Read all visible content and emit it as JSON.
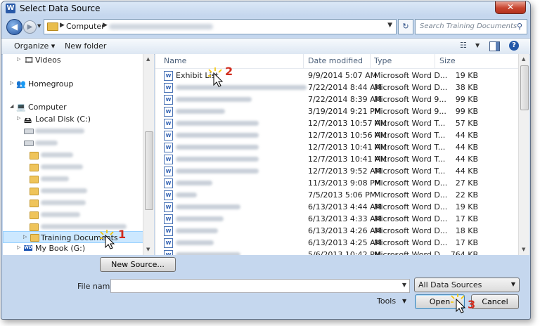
{
  "window": {
    "title": "Select Data Source",
    "app_icon": "W",
    "close_glyph": "✕"
  },
  "navigation": {
    "back_glyph": "◀",
    "forward_glyph": "▶",
    "recent_glyph": "▼",
    "address_root": "Computer",
    "address_sep": "▶",
    "address_dropdown": "▼",
    "refresh_glyph": "↻",
    "search_placeholder": "Search Training Documents",
    "search_glyph": "⚲"
  },
  "toolbar": {
    "organize": "Organize ▾",
    "new_folder": "New folder",
    "view_glyph": "☷",
    "view_dd": "▼",
    "help": "?"
  },
  "nav_pane": {
    "items": [
      {
        "label": "Videos",
        "indent": 1,
        "arrow": "▷",
        "icon": "🎞"
      },
      {
        "label": "Homegroup",
        "indent": 0,
        "arrow": "▷",
        "icon": "👥"
      },
      {
        "label": "Computer",
        "indent": 0,
        "arrow": "◢",
        "icon": "💻"
      },
      {
        "label": "Local Disk (C:)",
        "indent": 1,
        "arrow": "▷",
        "icon": "🖴"
      },
      {
        "label": "My Book (G:)",
        "indent": 1,
        "arrow": "▷",
        "icon": "WD"
      },
      {
        "label": "Training Documents",
        "indent": 2,
        "arrow": "▷",
        "icon": "folder"
      }
    ]
  },
  "columns": {
    "name": "Name",
    "date": "Date modified",
    "type": "Type",
    "size": "Size"
  },
  "files": [
    {
      "name": "Exhibit List",
      "date": "9/9/2014 5:07 AM",
      "type": "Microsoft Word D...",
      "size": "19 KB",
      "blurred": false
    },
    {
      "name": "",
      "date": "7/22/2014 8:44 AM",
      "type": "Microsoft Word D...",
      "size": "38 KB",
      "blurred": true
    },
    {
      "name": "",
      "date": "7/22/2014 8:39 AM",
      "type": "Microsoft Word 9...",
      "size": "99 KB",
      "blurred": true
    },
    {
      "name": "",
      "date": "3/19/2014 9:21 PM",
      "type": "Microsoft Word 9...",
      "size": "99 KB",
      "blurred": true
    },
    {
      "name": "",
      "date": "12/7/2013 10:57 AM",
      "type": "Microsoft Word T...",
      "size": "57 KB",
      "blurred": true
    },
    {
      "name": "",
      "date": "12/7/2013 10:56 AM",
      "type": "Microsoft Word T...",
      "size": "44 KB",
      "blurred": true
    },
    {
      "name": "",
      "date": "12/7/2013 10:41 AM",
      "type": "Microsoft Word T...",
      "size": "44 KB",
      "blurred": true
    },
    {
      "name": "",
      "date": "12/7/2013 10:41 AM",
      "type": "Microsoft Word T...",
      "size": "44 KB",
      "blurred": true
    },
    {
      "name": "",
      "date": "12/7/2013 9:52 AM",
      "type": "Microsoft Word T...",
      "size": "44 KB",
      "blurred": true
    },
    {
      "name": "",
      "date": "11/3/2013 9:08 PM",
      "type": "Microsoft Word D...",
      "size": "27 KB",
      "blurred": true
    },
    {
      "name": "",
      "date": "7/5/2013 5:06 PM",
      "type": "Microsoft Word D...",
      "size": "22 KB",
      "blurred": true
    },
    {
      "name": "",
      "date": "6/13/2013 4:44 AM",
      "type": "Microsoft Word D...",
      "size": "19 KB",
      "blurred": true
    },
    {
      "name": "",
      "date": "6/13/2013 4:33 AM",
      "type": "Microsoft Word D...",
      "size": "17 KB",
      "blurred": true
    },
    {
      "name": "",
      "date": "6/13/2013 4:26 AM",
      "type": "Microsoft Word D...",
      "size": "18 KB",
      "blurred": true
    },
    {
      "name": "",
      "date": "6/13/2013 4:25 AM",
      "type": "Microsoft Word D...",
      "size": "17 KB",
      "blurred": true
    },
    {
      "name": "",
      "date": "5/6/2013 10:42 PM",
      "type": "Microsoft Word D...",
      "size": "764 KB",
      "blurred": true
    }
  ],
  "scroll_arrows": {
    "up": "▲",
    "down": "▼"
  },
  "buttons": {
    "new_source": "New Source...",
    "open": "Open",
    "cancel": "Cancel",
    "tools": "Tools",
    "tools_dd": "▼"
  },
  "file_name": {
    "label": "File name:",
    "value": "",
    "dd": "▼"
  },
  "file_type": {
    "selected": "All Data Sources",
    "dd": "▼"
  },
  "step_badges": [
    "1",
    "2",
    "3"
  ],
  "colors": {
    "accent": "#2458a8",
    "selection": "#cce8ff",
    "badge": "#d12b1c",
    "cursor_glow": "#f5c400"
  }
}
